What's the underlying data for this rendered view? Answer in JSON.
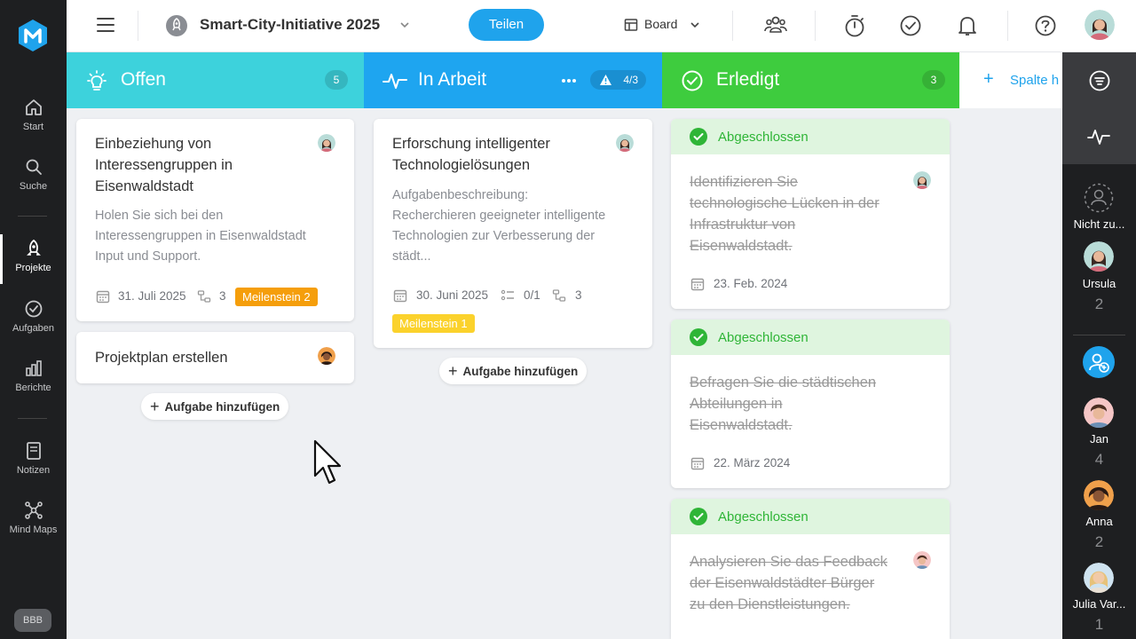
{
  "nav": {
    "items": [
      {
        "label": "Start",
        "icon": "home-icon"
      },
      {
        "label": "Suche",
        "icon": "search-icon"
      },
      {
        "label": "Projekte",
        "icon": "rocket-icon"
      },
      {
        "label": "Aufgaben",
        "icon": "check-circle-icon"
      },
      {
        "label": "Berichte",
        "icon": "bar-chart-icon"
      },
      {
        "label": "Notizen",
        "icon": "note-icon"
      },
      {
        "label": "Mind Maps",
        "icon": "mind-map-icon"
      }
    ],
    "workspace": "BBB"
  },
  "topbar": {
    "project_title": "Smart-City-Initiative 2025",
    "share_label": "Teilen",
    "view_label": "Board"
  },
  "columns": [
    {
      "title": "Offen",
      "count": "5",
      "color": "#3dd2dc"
    },
    {
      "title": "In Arbeit",
      "count": "4/3",
      "color": "#1ea5f0"
    },
    {
      "title": "Erledigt",
      "count": "3",
      "color": "#3ecc3e"
    }
  ],
  "add_column_label": "Spalte h",
  "offen_cards": [
    {
      "title_lines": [
        "Einbeziehung von",
        "Interessengruppen in",
        "Eisenwaldstadt"
      ],
      "desc_lines": [
        "Holen Sie sich bei den",
        "Interessengruppen in Eisenwaldstadt",
        "Input und Support."
      ],
      "date": "31. Juli 2025",
      "subtasks": "3",
      "milestone": "Meilenstein 2",
      "milestone_color": "#f59e0b"
    },
    {
      "title_lines": [
        "Projektplan erstellen"
      ]
    }
  ],
  "arbeit_cards": [
    {
      "title_lines": [
        "Erforschung intelligenter",
        "Technologielösungen"
      ],
      "desc_lines": [
        "Aufgabenbeschreibung:",
        "Recherchieren geeigneter intelligente",
        "Technologien zur Verbesserung der",
        "städt..."
      ],
      "date": "30. Juni 2025",
      "checklist": "0/1",
      "subtasks": "3",
      "milestone": "Meilenstein 1",
      "milestone_color": "#fbd22c"
    }
  ],
  "add_task_label": "Aufgabe hinzufügen",
  "done_cards": [
    {
      "status": "Abgeschlossen",
      "title_lines": [
        "Identifizieren Sie",
        "technologische Lücken in der",
        "Infrastruktur von",
        "Eisenwaldstadt."
      ],
      "date": "23. Feb. 2024"
    },
    {
      "status": "Abgeschlossen",
      "title_lines": [
        "Befragen Sie die städtischen",
        "Abteilungen in",
        "Eisenwaldstadt."
      ],
      "date": "22. März 2024"
    },
    {
      "status": "Abgeschlossen",
      "title_lines": [
        "Analysieren Sie das Feedback",
        "der Eisenwaldstädter Bürger",
        "zu den Dienstleistungen."
      ]
    }
  ],
  "assignees": [
    {
      "name": "Nicht zu...",
      "count": ""
    },
    {
      "name": "Ursula",
      "count": "2"
    },
    {
      "name": "Jan",
      "count": "4"
    },
    {
      "name": "Anna",
      "count": "2"
    },
    {
      "name": "Julia Var...",
      "count": "1"
    }
  ]
}
